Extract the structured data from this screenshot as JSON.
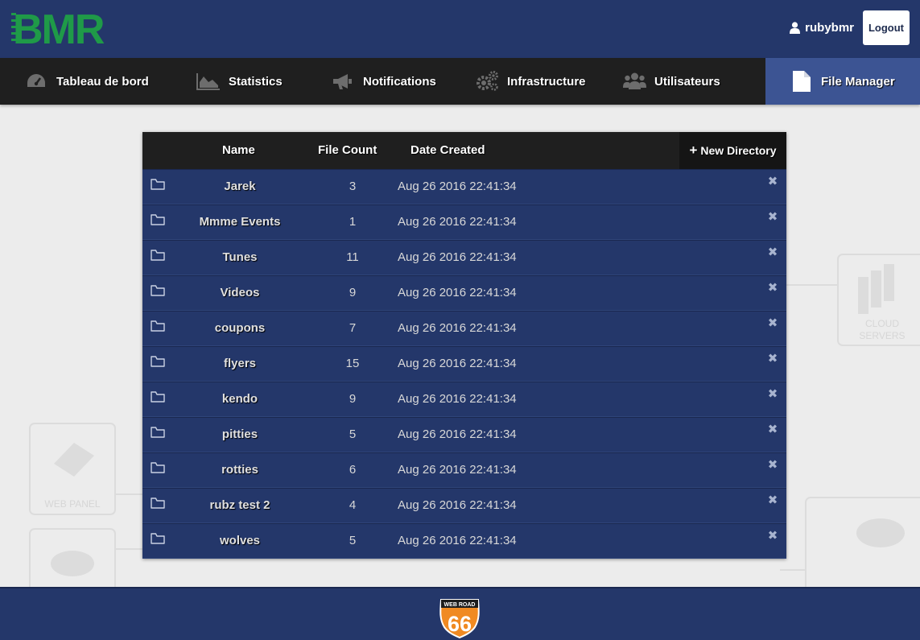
{
  "header": {
    "logo_text": "BMR",
    "username": "rubybmr",
    "logout_label": "Logout"
  },
  "nav": [
    {
      "label": "Tableau de bord",
      "icon": "dashboard-icon",
      "active": false
    },
    {
      "label": "Statistics",
      "icon": "area-chart-icon",
      "active": false
    },
    {
      "label": "Notifications",
      "icon": "megaphone-icon",
      "active": false
    },
    {
      "label": "Infrastructure",
      "icon": "gears-icon",
      "active": false
    },
    {
      "label": "Utilisateurs",
      "icon": "users-icon",
      "active": false
    },
    {
      "label": "File Manager",
      "icon": "file-icon",
      "active": true
    }
  ],
  "table": {
    "columns": {
      "name": "Name",
      "file_count": "File Count",
      "date_created": "Date Created"
    },
    "new_directory_label": "New Directory",
    "rows": [
      {
        "name": "Jarek",
        "count": "3",
        "date": "Aug 26 2016 22:41:34"
      },
      {
        "name": "Mmme Events",
        "count": "1",
        "date": "Aug 26 2016 22:41:34"
      },
      {
        "name": "Tunes",
        "count": "11",
        "date": "Aug 26 2016 22:41:34"
      },
      {
        "name": "Videos",
        "count": "9",
        "date": "Aug 26 2016 22:41:34"
      },
      {
        "name": "coupons",
        "count": "7",
        "date": "Aug 26 2016 22:41:34"
      },
      {
        "name": "flyers",
        "count": "15",
        "date": "Aug 26 2016 22:41:34"
      },
      {
        "name": "kendo",
        "count": "9",
        "date": "Aug 26 2016 22:41:34"
      },
      {
        "name": "pitties",
        "count": "5",
        "date": "Aug 26 2016 22:41:34"
      },
      {
        "name": "rotties",
        "count": "6",
        "date": "Aug 26 2016 22:41:34"
      },
      {
        "name": "rubz test 2",
        "count": "4",
        "date": "Aug 26 2016 22:41:34"
      },
      {
        "name": "wolves",
        "count": "5",
        "date": "Aug 26 2016 22:41:34"
      }
    ]
  },
  "background": {
    "cloud_servers_label": "CLOUD SERVERS",
    "cloud_line1": "CLOUD",
    "cloud_line2": "SERVERS",
    "web_panel_label": "WEB PANEL"
  },
  "footer": {
    "badge_top": "WEB ROAD",
    "badge_number": "66"
  },
  "colors": {
    "primary": "#24376a",
    "nav_bg": "#1f1f1f",
    "active_tab": "#3c5493",
    "logo_green": "#1f9a48"
  }
}
